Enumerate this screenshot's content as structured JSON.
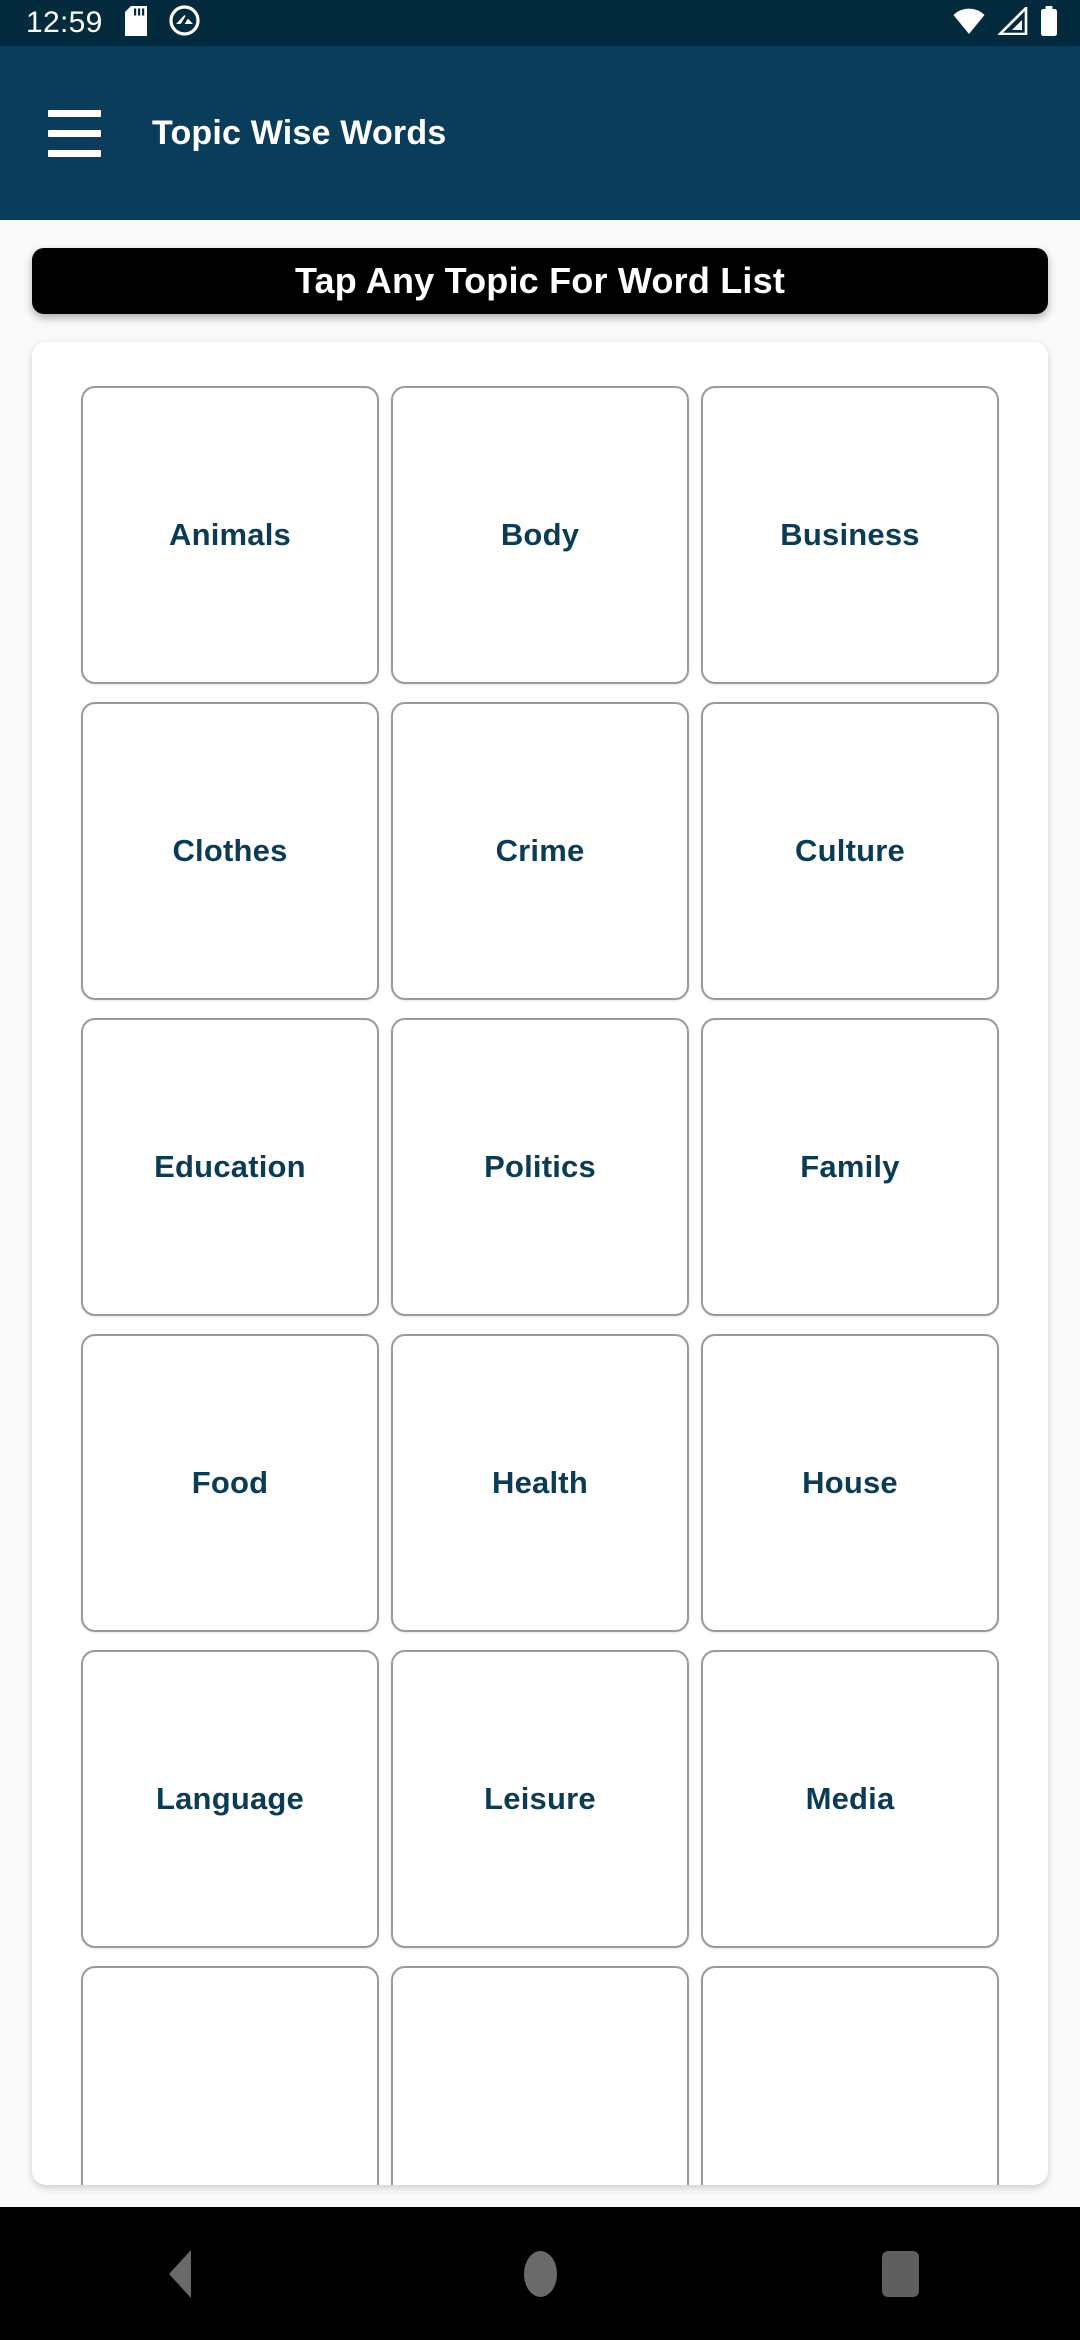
{
  "status_bar": {
    "clock": "12:59",
    "left_icons": [
      {
        "name": "sd-card-icon"
      },
      {
        "name": "data-saver-icon"
      }
    ],
    "right_icons": [
      {
        "name": "wifi-icon"
      },
      {
        "name": "cellular-signal-icon"
      },
      {
        "name": "battery-icon"
      }
    ],
    "background_color": "#042a3d"
  },
  "app_bar": {
    "title": "Topic Wise Words",
    "menu_icon": "hamburger-menu-icon",
    "background_color": "#0a3d5c",
    "text_color": "#ffffff"
  },
  "banner": {
    "text": "Tap Any Topic For Word List",
    "background_color": "#000000",
    "text_color": "#ffffff"
  },
  "topic_grid": {
    "columns": 3,
    "card_text_color": "#0c3c55",
    "card_border_color": "#9a9a9a",
    "topics": [
      {
        "label": "Animals"
      },
      {
        "label": "Body"
      },
      {
        "label": "Business"
      },
      {
        "label": "Clothes"
      },
      {
        "label": "Crime"
      },
      {
        "label": "Culture"
      },
      {
        "label": "Education"
      },
      {
        "label": "Politics"
      },
      {
        "label": "Family"
      },
      {
        "label": "Food"
      },
      {
        "label": "Health"
      },
      {
        "label": "House"
      },
      {
        "label": "Language"
      },
      {
        "label": "Leisure"
      },
      {
        "label": "Media"
      },
      {
        "label": ""
      },
      {
        "label": ""
      },
      {
        "label": ""
      }
    ]
  },
  "nav_bar": {
    "background_color": "#000000",
    "buttons": [
      {
        "name": "back-button",
        "icon": "triangle-back-icon"
      },
      {
        "name": "home-button",
        "icon": "circle-home-icon"
      },
      {
        "name": "recents-button",
        "icon": "square-recents-icon"
      }
    ]
  }
}
